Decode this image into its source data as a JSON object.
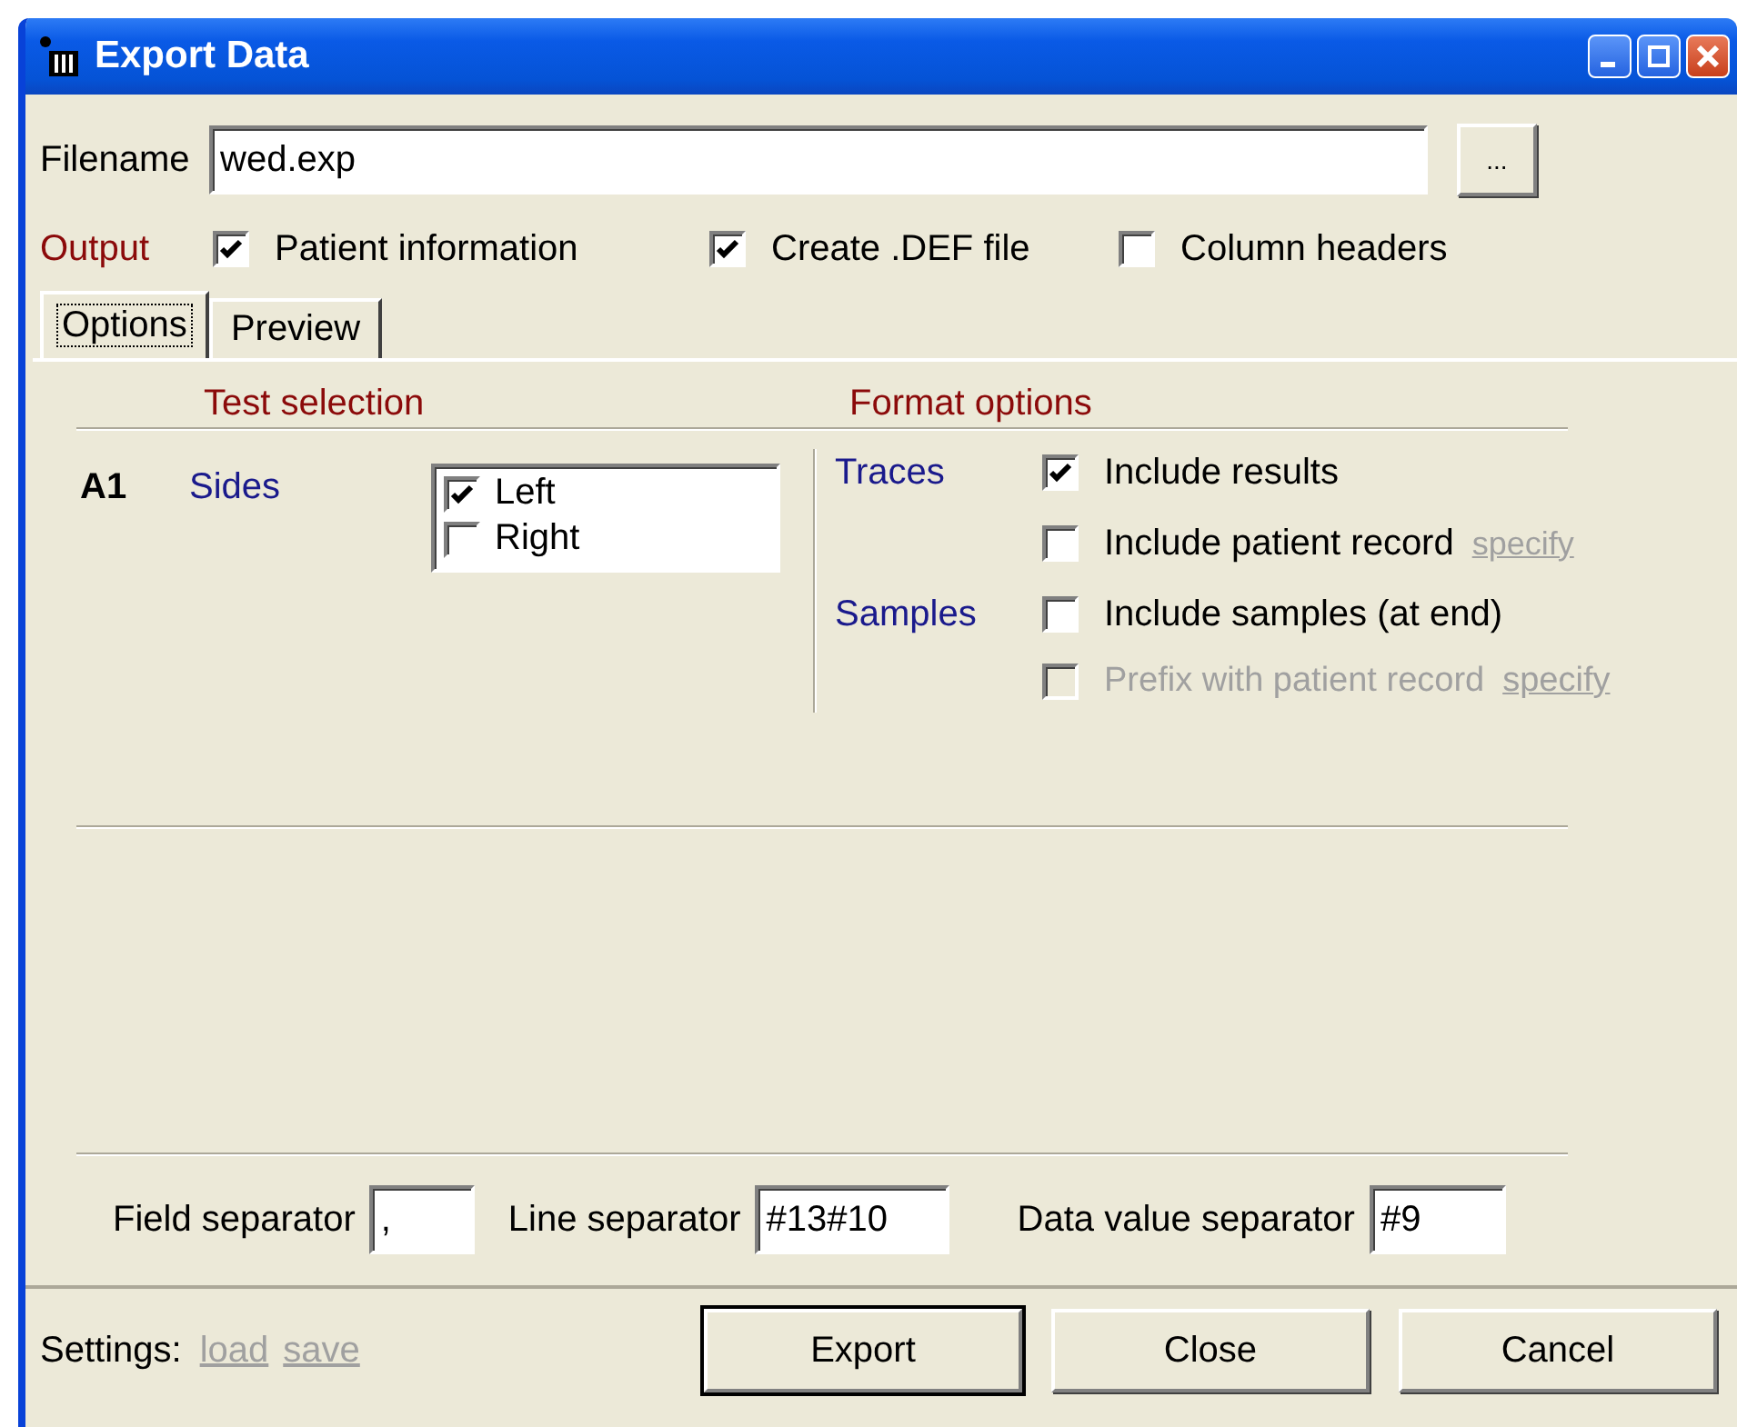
{
  "window": {
    "title": "Export Data"
  },
  "filename": {
    "label": "Filename",
    "value": "wed.exp",
    "browse": "..."
  },
  "output": {
    "label": "Output",
    "options": [
      {
        "label": "Patient information",
        "checked": true
      },
      {
        "label": "Create .DEF file",
        "checked": true
      },
      {
        "label": "Column headers",
        "checked": false
      }
    ]
  },
  "tabs": [
    {
      "label": "Options",
      "selected": true
    },
    {
      "label": "Preview",
      "selected": false
    }
  ],
  "test_selection": {
    "heading": "Test selection",
    "test": "A1",
    "group": "Sides",
    "items": [
      {
        "label": "Left",
        "checked": true
      },
      {
        "label": "Right",
        "checked": false
      }
    ]
  },
  "format_options": {
    "heading": "Format options",
    "rows": [
      {
        "group": "Traces",
        "label": "Include results",
        "checked": true,
        "disabled": false
      },
      {
        "label": "Include patient record",
        "checked": false,
        "disabled": false,
        "link": "specify"
      },
      {
        "group": "Samples",
        "label": "Include samples (at end)",
        "checked": false,
        "disabled": false
      },
      {
        "label": "Prefix with patient record",
        "checked": false,
        "disabled": true,
        "link": "specify"
      }
    ]
  },
  "separators": [
    {
      "label": "Field separator",
      "value": ","
    },
    {
      "label": "Line separator",
      "value": "#13#10"
    },
    {
      "label": "Data value separator",
      "value": "#9"
    }
  ],
  "settings": {
    "label": "Settings:",
    "links": [
      "load",
      "save"
    ]
  },
  "buttons": [
    {
      "label": "Export",
      "default": true
    },
    {
      "label": "Close",
      "default": false
    },
    {
      "label": "Cancel",
      "default": false
    }
  ]
}
